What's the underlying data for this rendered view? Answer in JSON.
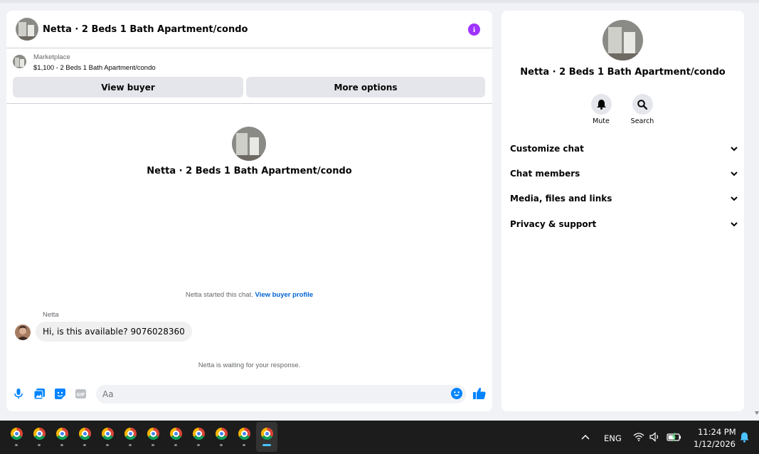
{
  "header": {
    "title": "Netta · 2 Beds 1 Bath Apartment/condo"
  },
  "marketplace": {
    "label": "Marketplace",
    "listing": "$1,100 - 2 Beds 1 Bath Apartment/condo",
    "view_buyer_label": "View buyer",
    "more_options_label": "More options"
  },
  "conversation": {
    "title": "Netta · 2 Beds 1 Bath Apartment/condo",
    "started_text": "Netta started this chat.",
    "view_buyer_profile_label": "View buyer profile",
    "sender_name": "Netta",
    "message": "Hi, is this available? 9076028360",
    "waiting_text": "Netta is waiting for your response."
  },
  "composer": {
    "placeholder": "Aa"
  },
  "sidebar": {
    "title": "Netta · 2 Beds 1 Bath Apartment/condo",
    "actions": [
      {
        "label": "Mute",
        "icon": "bell-icon"
      },
      {
        "label": "Search",
        "icon": "search-icon"
      }
    ],
    "sections": [
      {
        "label": "Customize chat"
      },
      {
        "label": "Chat members"
      },
      {
        "label": "Media, files and links"
      },
      {
        "label": "Privacy & support"
      }
    ]
  },
  "taskbar": {
    "apps": [
      "Chrome",
      "Chrome",
      "Chrome",
      "Chrome",
      "Chrome",
      "Chrome",
      "Chrome",
      "Chrome",
      "Chrome",
      "Chrome",
      "Chrome",
      "Chrome"
    ],
    "language": "ENG",
    "time": "11:24 PM",
    "date": "1/12/2026"
  },
  "colors": {
    "accent_blue": "#0084ff",
    "link_blue": "#0064d1",
    "info_purple": "#a033ff",
    "button_gray": "#e4e6eb"
  }
}
